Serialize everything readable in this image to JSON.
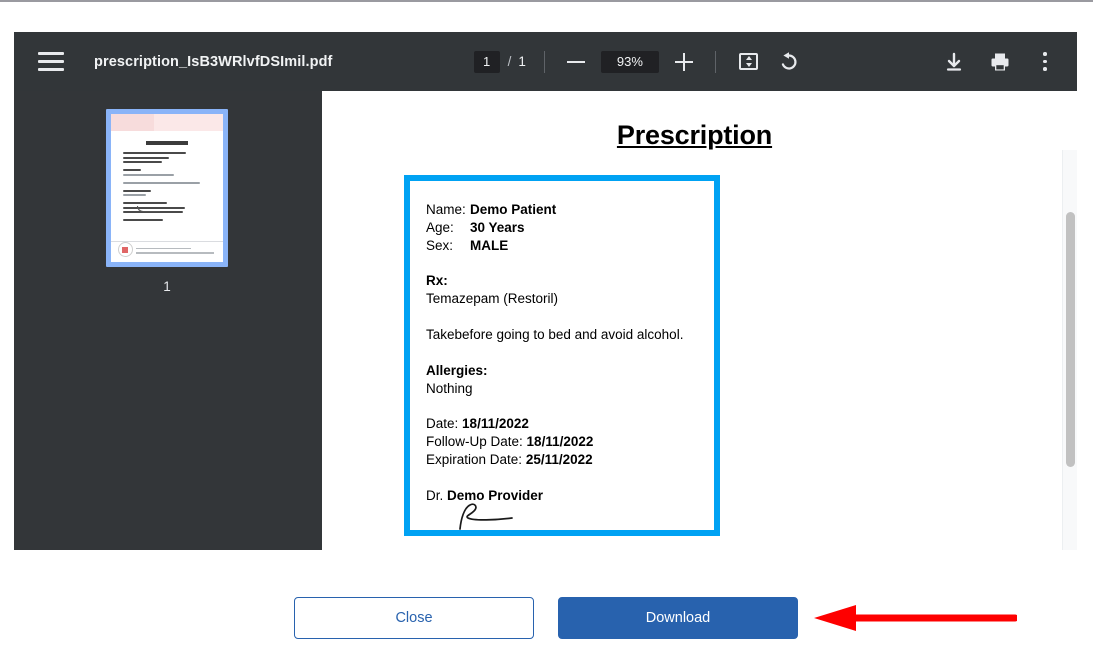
{
  "viewer": {
    "menu_icon": "hamburger-menu-icon",
    "document_title": "prescription_IsB3WRlvfDSImil.pdf",
    "page_current": "1",
    "page_separator": "/",
    "page_total": "1",
    "zoom_level": "93%",
    "zoom_out_icon": "minus-icon",
    "zoom_in_icon": "plus-icon",
    "fit_icon": "fit-to-page-icon",
    "rotate_icon": "rotate-counterclockwise-icon",
    "download_icon": "download-icon",
    "print_icon": "print-icon",
    "more_icon": "more-options-kebab-icon",
    "thumbnail_page_label": "1"
  },
  "document": {
    "title": "Prescription",
    "fields": [
      {
        "label": "Name:",
        "value": "Demo Patient"
      },
      {
        "label": "Age:",
        "value": "30 Years"
      },
      {
        "label": "Sex:",
        "value": "MALE"
      }
    ],
    "rx_heading": "Rx:",
    "rx_medication": "Temazepam (Restoril)",
    "instructions": "Takebefore going to bed and avoid alcohol.",
    "allergies_heading": "Allergies:",
    "allergies_value": "Nothing",
    "date_label": "Date:",
    "date_value": "18/11/2022",
    "followup_label": "Follow-Up Date:",
    "followup_value": "18/11/2022",
    "expiration_label": "Expiration Date:",
    "expiration_value": "25/11/2022",
    "provider_prefix": "Dr.",
    "provider_name": "Demo Provider",
    "signature": "handwritten-signature"
  },
  "actions": {
    "close_label": "Close",
    "download_label": "Download"
  },
  "annotation": {
    "arrow": "red-left-arrow-pointing-to-download"
  },
  "colors": {
    "toolbar_bg": "#323639",
    "sidebar_bg": "#333639",
    "box_border": "#00a2f3",
    "primary_button": "#2862ae",
    "annotation_red": "#fe0000",
    "thumbnail_highlight": "#8ab4f8"
  }
}
